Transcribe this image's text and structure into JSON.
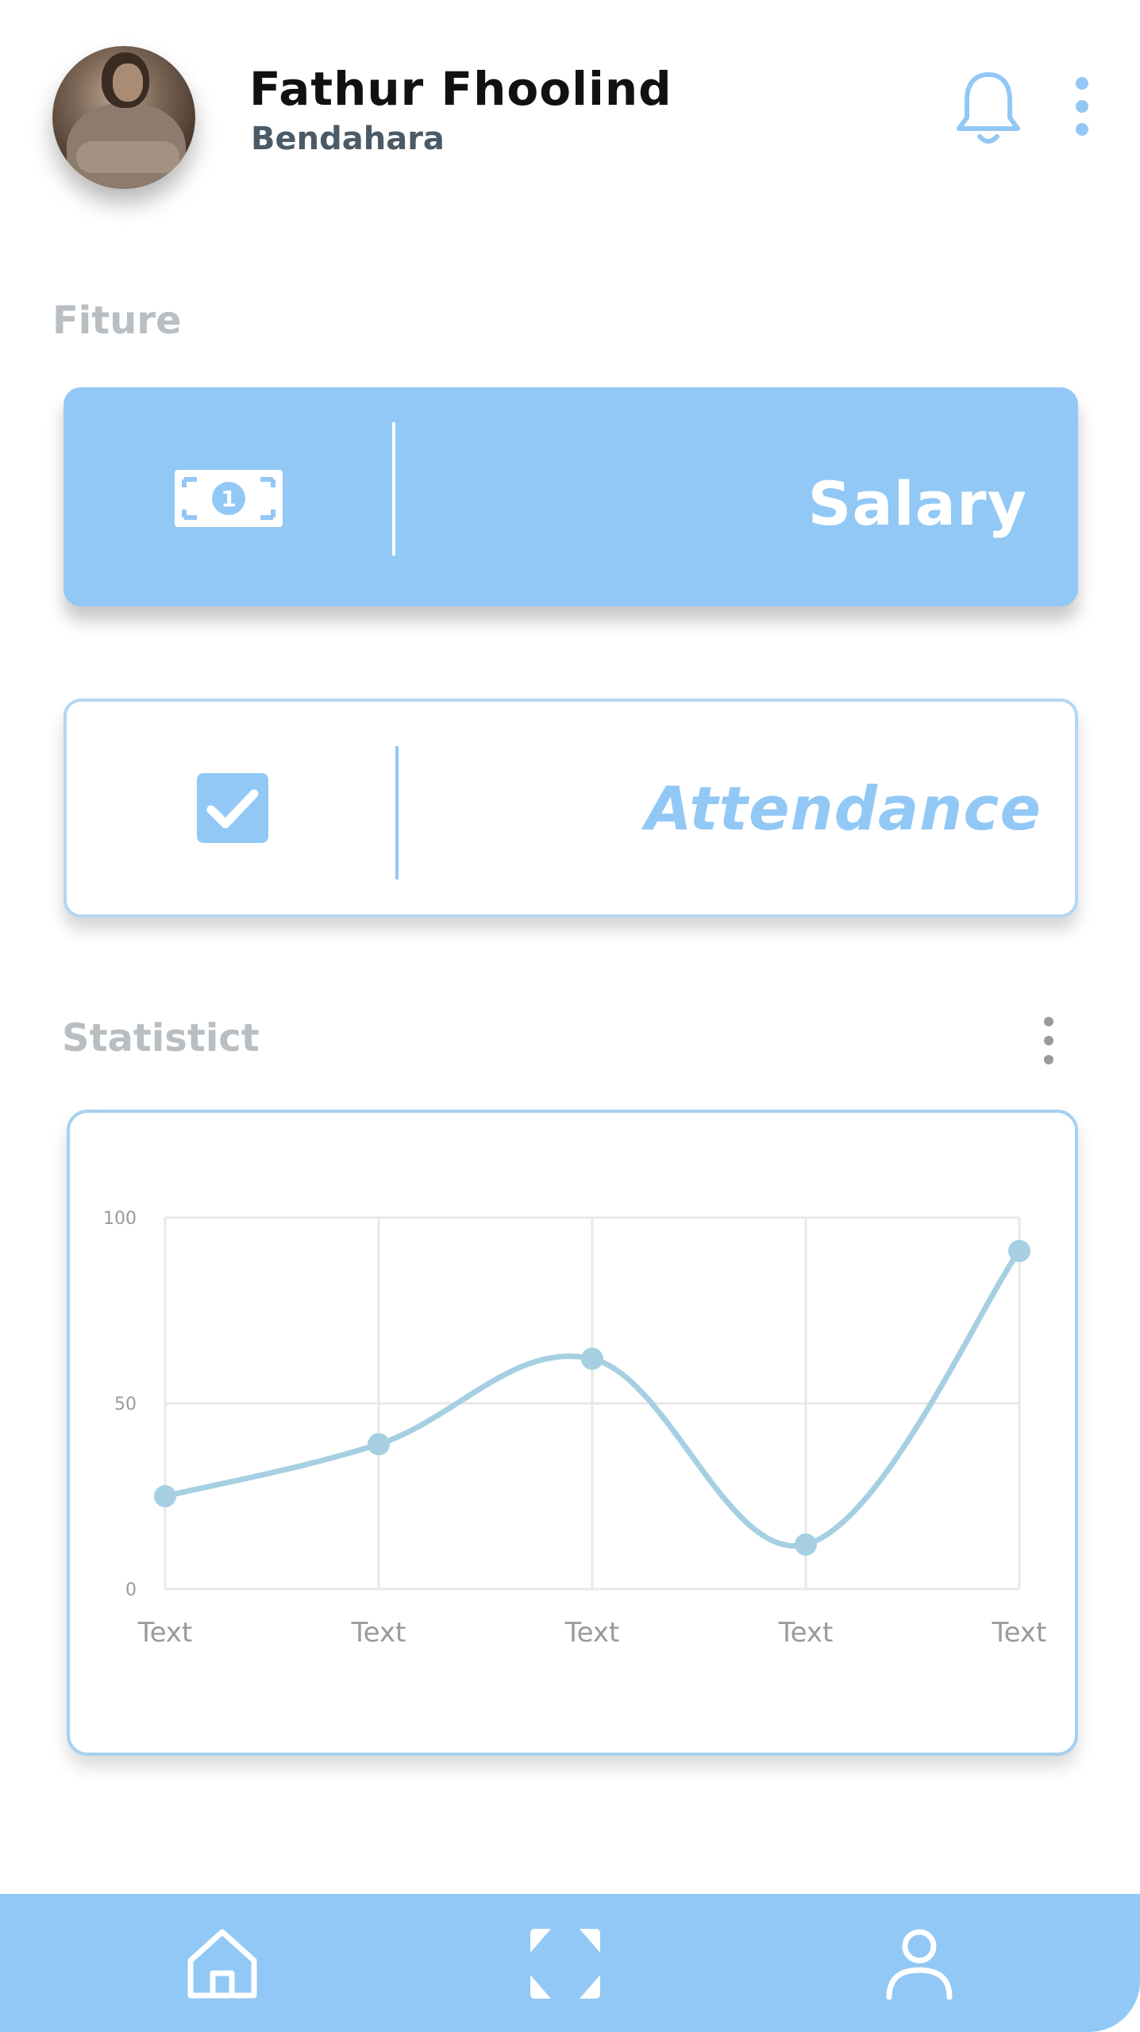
{
  "profile": {
    "name": "Fathur  Fhoolind",
    "role": "Bendahara"
  },
  "icons": {
    "notification": "bell-icon",
    "menu": "kebab-menu-icon",
    "salary": "money-bill-icon",
    "attendance": "checkbox-checked-icon",
    "nav_home": "home-icon",
    "nav_scan": "scan-icon",
    "nav_profile": "user-icon"
  },
  "sections": {
    "features_label": "Fiture",
    "statistics_label": "Statistict"
  },
  "features": [
    {
      "label": "Salary"
    },
    {
      "label": "Attendance"
    }
  ],
  "colors": {
    "accent": "#92c8f5",
    "line": "#a6cfe2",
    "grid": "#e8e8e8",
    "tick": "#9a9a9a"
  },
  "chart_data": {
    "type": "line",
    "categories": [
      "Text",
      "Text",
      "Text",
      "Text",
      "Text"
    ],
    "values": [
      25,
      39,
      62,
      12,
      91
    ],
    "yticks": [
      "0",
      "50",
      "100"
    ],
    "ylim": [
      0,
      100
    ],
    "grid": true,
    "smooth": true
  }
}
